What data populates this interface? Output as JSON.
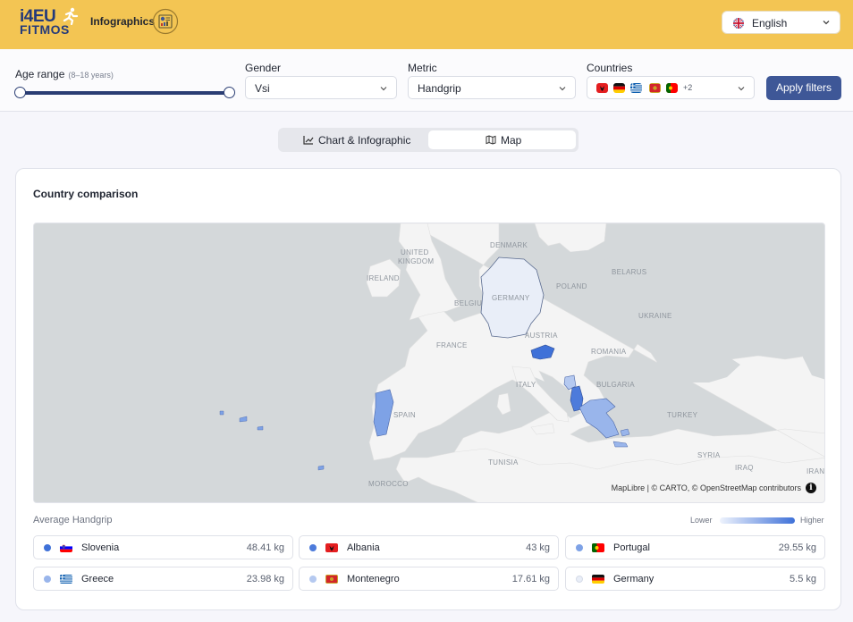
{
  "header": {
    "logo_line1": "i4EU",
    "logo_line2": "FITMOS",
    "subtitle": "Infographics",
    "language": {
      "label": "English",
      "icon": "uk-flag-icon"
    }
  },
  "filters": {
    "age": {
      "label": "Age range",
      "hint": "(8–18 years)",
      "min": 8,
      "max": 18,
      "low": 8,
      "high": 18
    },
    "gender": {
      "label": "Gender",
      "value": "Vsi"
    },
    "metric": {
      "label": "Metric",
      "value": "Handgrip"
    },
    "countries": {
      "label": "Countries",
      "more": "+2",
      "flags": [
        "albania",
        "germany",
        "greece",
        "montenegro",
        "portugal"
      ]
    },
    "apply_label": "Apply filters"
  },
  "view_toggle": {
    "tabs": [
      {
        "label": "Chart & Infographic",
        "icon": "chart-icon",
        "active": false
      },
      {
        "label": "Map",
        "icon": "map-icon",
        "active": true
      }
    ]
  },
  "card": {
    "title": "Country comparison",
    "map": {
      "labels": {
        "denmark": "DENMARK",
        "uk": "UNITED",
        "uk2": "KINGDOM",
        "ireland": "IRELAND",
        "germany": "GERMANY",
        "belarus": "BELARUS",
        "poland": "POLAND",
        "belgium": "BELGIU",
        "ukraine": "UKRAINE",
        "austria": "AUSTRIA",
        "france": "FRANCE",
        "romania": "ROMANIA",
        "italy": "ITALY",
        "bulgaria": "BULGARIA",
        "spain": "SPAIN",
        "turkey": "TURKEY",
        "tunisia": "TUNISIA",
        "syria": "SYRIA",
        "iraq": "IRAQ",
        "iran": "IRAN",
        "morocco": "MOROCCO"
      },
      "attribution": "MapLibre | © CARTO, © OpenStreetMap contributors",
      "info": "i"
    },
    "legend": {
      "metric_label": "Average Handgrip",
      "lower": "Lower",
      "higher": "Higher",
      "color_low": "#eef3fd",
      "color_high": "#3f71d8"
    },
    "countries": [
      {
        "name": "Slovenia",
        "value": "48.41 kg",
        "color": "#3f71d8",
        "flag": "slovenia"
      },
      {
        "name": "Albania",
        "value": "43 kg",
        "color": "#4d7bdb",
        "flag": "albania"
      },
      {
        "name": "Portugal",
        "value": "29.55 kg",
        "color": "#7ea2e6",
        "flag": "portugal"
      },
      {
        "name": "Greece",
        "value": "23.98 kg",
        "color": "#99b5eb",
        "flag": "greece"
      },
      {
        "name": "Montenegro",
        "value": "17.61 kg",
        "color": "#b5c9f0",
        "flag": "montenegro"
      },
      {
        "name": "Germany",
        "value": "5.5 kg",
        "color": "#e9eef8",
        "flag": "germany"
      }
    ]
  }
}
